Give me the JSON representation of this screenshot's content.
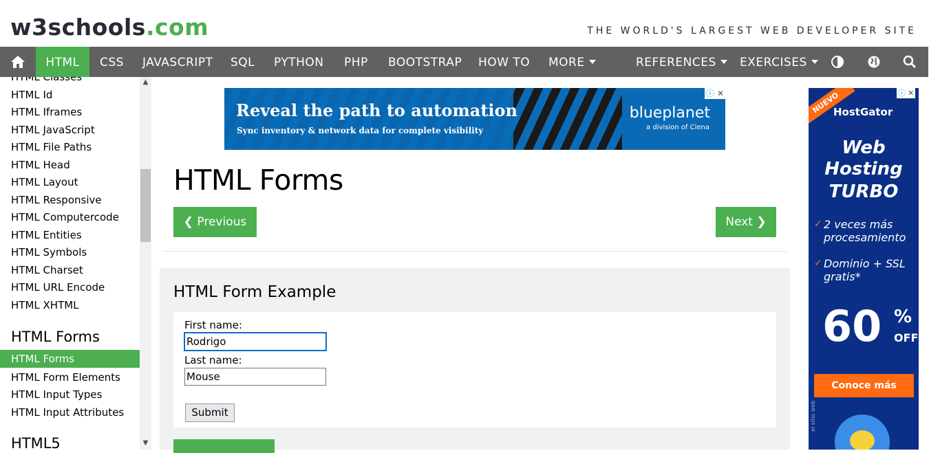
{
  "header": {
    "logo_main": "w3schools",
    "logo_com": ".com",
    "tagline": "THE WORLD'S LARGEST WEB DEVELOPER SITE"
  },
  "nav": {
    "items": [
      "HTML",
      "CSS",
      "JAVASCRIPT",
      "SQL",
      "PYTHON",
      "PHP",
      "BOOTSTRAP",
      "HOW TO",
      "MORE",
      "REFERENCES",
      "EXERCISES"
    ],
    "active": "HTML",
    "icons": [
      "home-icon",
      "contrast-icon",
      "globe-icon",
      "search-icon"
    ]
  },
  "sidebar": {
    "links_top": [
      "HTML Classes",
      "HTML Id",
      "HTML Iframes",
      "HTML JavaScript",
      "HTML File Paths",
      "HTML Head",
      "HTML Layout",
      "HTML Responsive",
      "HTML Computercode",
      "HTML Entities",
      "HTML Symbols",
      "HTML Charset",
      "HTML URL Encode",
      "HTML XHTML"
    ],
    "heading_forms": "HTML Forms",
    "active_link": "HTML Forms",
    "links_forms": [
      "HTML Form Elements",
      "HTML Input Types",
      "HTML Input Attributes"
    ],
    "heading_html5": "HTML5"
  },
  "ad_top": {
    "headline": "Reveal the path to automation",
    "sub": "Sync inventory & network data for complete visibility",
    "brand": "blueplanet",
    "brand_sub": "a division of Ciena"
  },
  "main": {
    "title": "HTML Forms",
    "prev_label": "❮ Previous",
    "next_label": "Next ❯",
    "example_title": "HTML Form Example",
    "form": {
      "first_label": "First name:",
      "first_value": "Rodrigo",
      "last_label": "Last name:",
      "last_value": "Mouse",
      "submit_label": "Submit"
    }
  },
  "ad_right": {
    "ribbon": "NUEVO",
    "brand": "HostGator",
    "line1": "Web",
    "line2": "Hosting",
    "line3": "TURBO",
    "feat1": "2 veces más procesamiento",
    "feat2": "Dominio + SSL gratis*",
    "percent": "60",
    "pct_sign": "%",
    "off": "OFF",
    "cta": "Conoce más",
    "side": "el sitio web"
  },
  "colors": {
    "accent": "#4caf50",
    "nav_bg": "#616161",
    "example_bg": "#f1f1f1"
  }
}
